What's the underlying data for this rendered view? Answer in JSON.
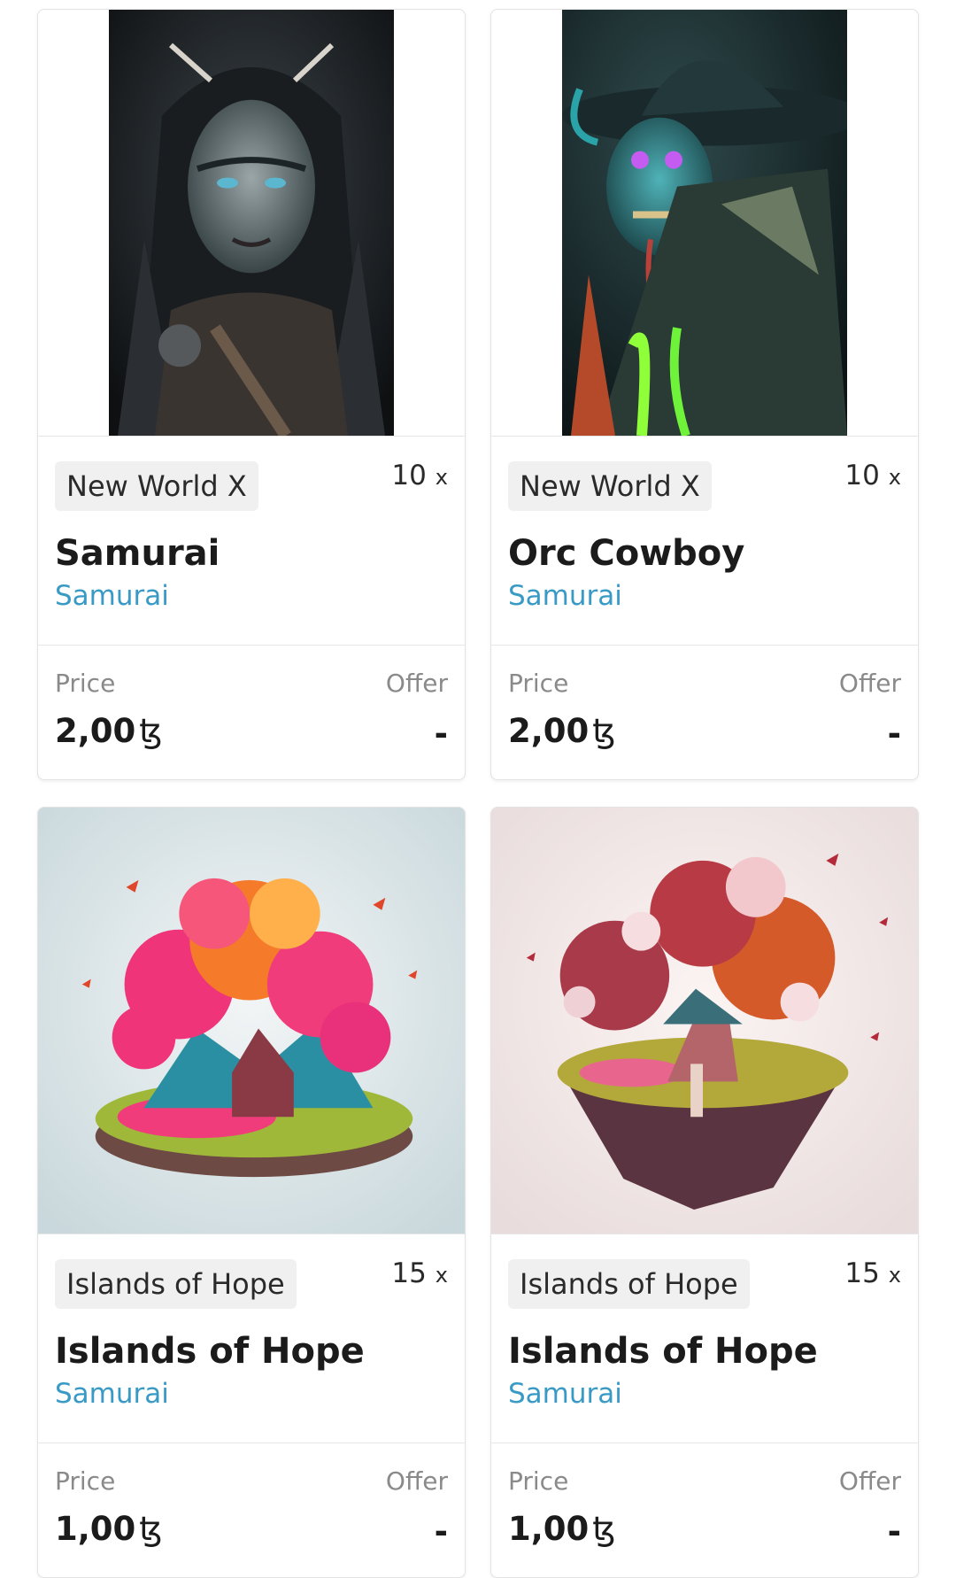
{
  "listings": [
    {
      "collection": "New World X",
      "editions": "10",
      "editions_suffix": "x",
      "title": "Samurai",
      "artist": "Samurai",
      "price_label": "Price",
      "price": "2,00",
      "currency": "ꜩ",
      "offer_label": "Offer",
      "offer": "-",
      "image_icon": "samurai-artwork"
    },
    {
      "collection": "New World X",
      "editions": "10",
      "editions_suffix": "x",
      "title": "Orc Cowboy",
      "artist": "Samurai",
      "price_label": "Price",
      "price": "2,00",
      "currency": "ꜩ",
      "offer_label": "Offer",
      "offer": "-",
      "image_icon": "orc-cowboy-artwork"
    },
    {
      "collection": "Islands of Hope",
      "editions": "15",
      "editions_suffix": "x",
      "title": "Islands of Hope",
      "artist": "Samurai",
      "price_label": "Price",
      "price": "1,00",
      "currency": "ꜩ",
      "offer_label": "Offer",
      "offer": "-",
      "image_icon": "floating-island-artwork"
    },
    {
      "collection": "Islands of Hope",
      "editions": "15",
      "editions_suffix": "x",
      "title": "Islands of Hope",
      "artist": "Samurai",
      "price_label": "Price",
      "price": "1,00",
      "currency": "ꜩ",
      "offer_label": "Offer",
      "offer": "-",
      "image_icon": "floating-island-artwork"
    }
  ],
  "colors": {
    "artist_link": "#3a9ac6",
    "chip_background": "#f0f0f0",
    "label_gray": "#8a8a8a"
  }
}
